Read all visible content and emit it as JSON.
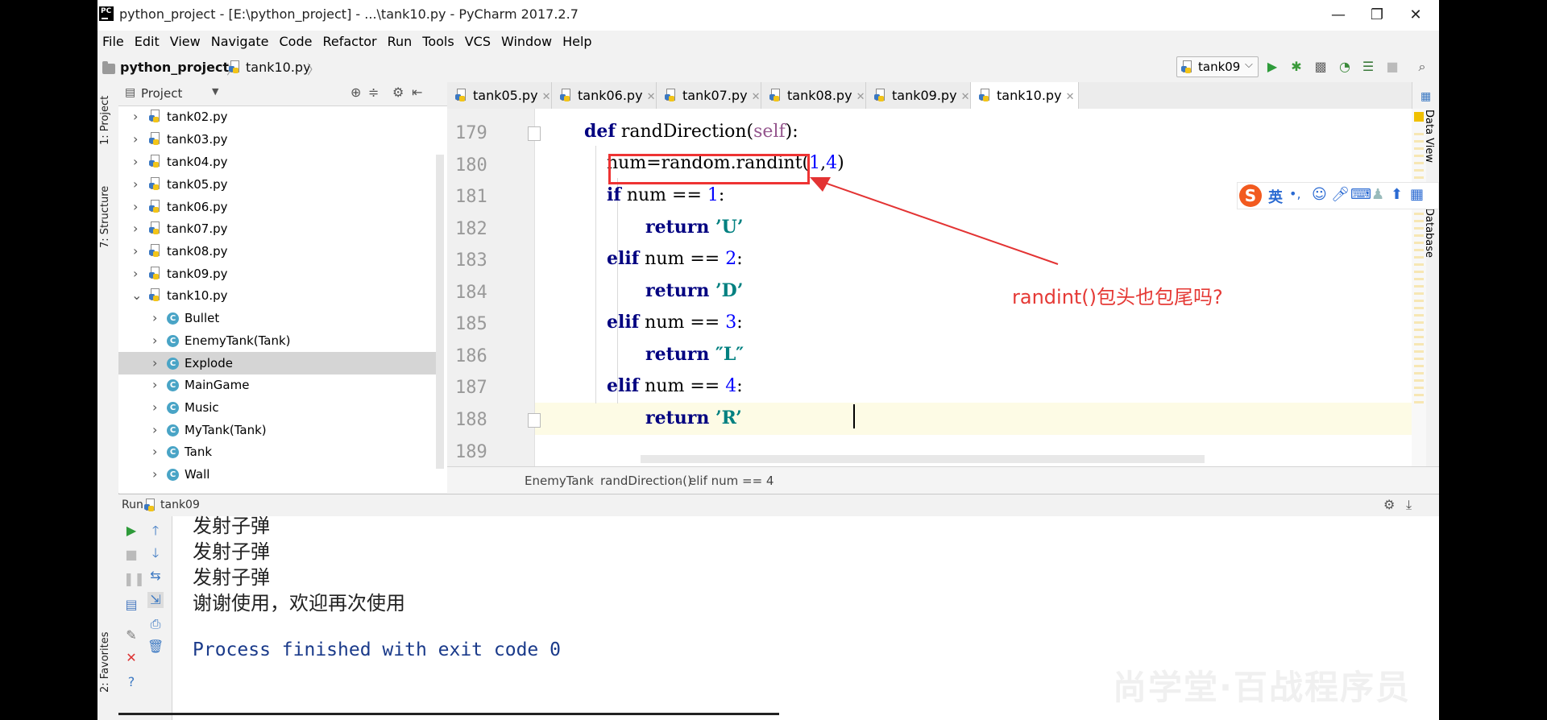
{
  "window": {
    "title": "python_project - [E:\\python_project] - ...\\tank10.py - PyCharm 2017.2.7",
    "logo_text": "PC",
    "minimize": "—",
    "restore": "❐",
    "close": "✕"
  },
  "menu": [
    "File",
    "Edit",
    "View",
    "Navigate",
    "Code",
    "Refactor",
    "Run",
    "Tools",
    "VCS",
    "Window",
    "Help"
  ],
  "navbar": {
    "project": "python_project",
    "file": "tank10.py",
    "run_config": "tank09"
  },
  "left_strip": {
    "project_tab": "1: Project",
    "structure_tab": "7: Structure",
    "favorites_tab": "2: Favorites"
  },
  "project_panel": {
    "title": "Project",
    "files": [
      "tank02.py",
      "tank03.py",
      "tank04.py",
      "tank05.py",
      "tank06.py",
      "tank07.py",
      "tank08.py",
      "tank09.py"
    ],
    "expanded_file": "tank10.py",
    "classes": [
      "Bullet",
      "EnemyTank(Tank)",
      "Explode",
      "MainGame",
      "Music",
      "MyTank(Tank)",
      "Tank",
      "Wall"
    ],
    "selected_class": "Explode"
  },
  "editor_tabs": [
    "tank05.py",
    "tank06.py",
    "tank07.py",
    "tank08.py",
    "tank09.py",
    "tank10.py"
  ],
  "active_tab": "tank10.py",
  "code": {
    "line_numbers": [
      "179",
      "180",
      "181",
      "182",
      "183",
      "184",
      "185",
      "186",
      "187",
      "188",
      "189"
    ],
    "l179": {
      "kw": "def",
      "name": " randDirection(",
      "self": "self",
      "end": "):"
    },
    "l180": {
      "text": "num=random.randint(",
      "a": "1",
      "sep": ",",
      "b": "4",
      "end": ")"
    },
    "l181": {
      "kw": "if",
      "text": " num == ",
      "n": "1",
      "end": ":"
    },
    "l182": {
      "kw": "return",
      "str": " ’U’"
    },
    "l183": {
      "kw": "elif",
      "text": " num == ",
      "n": "2",
      "end": ":"
    },
    "l184": {
      "kw": "return",
      "str": " ’D’"
    },
    "l185": {
      "kw": "elif",
      "text": " num == ",
      "n": "3",
      "end": ":"
    },
    "l186": {
      "kw": "return",
      "str": " ″L″"
    },
    "l187": {
      "kw": "elif",
      "text": " num == ",
      "n": "4",
      "end": ":"
    },
    "l188": {
      "kw": "return",
      "str": " ’R’"
    }
  },
  "annotation": "randint()包头也包尾吗?",
  "right_strip": {
    "data_view": "Data View",
    "database": "Database"
  },
  "ime_toolbar": {
    "logo": "S",
    "lang": "英",
    "punct": "•,"
  },
  "breadcrumb": [
    "EnemyTank",
    "randDirection()",
    "elif num == 4"
  ],
  "run_panel": {
    "label": "Run",
    "config": "tank09",
    "output": [
      "发射子弹",
      "发射子弹",
      "发射子弹",
      "谢谢使用，欢迎再次使用"
    ],
    "process": "Process finished with exit code 0"
  },
  "watermark": "尚学堂·百战程序员",
  "colors": {
    "accent_red": "#e33333",
    "keyword": "#000080",
    "number": "#0000ff",
    "string": "#008080"
  }
}
